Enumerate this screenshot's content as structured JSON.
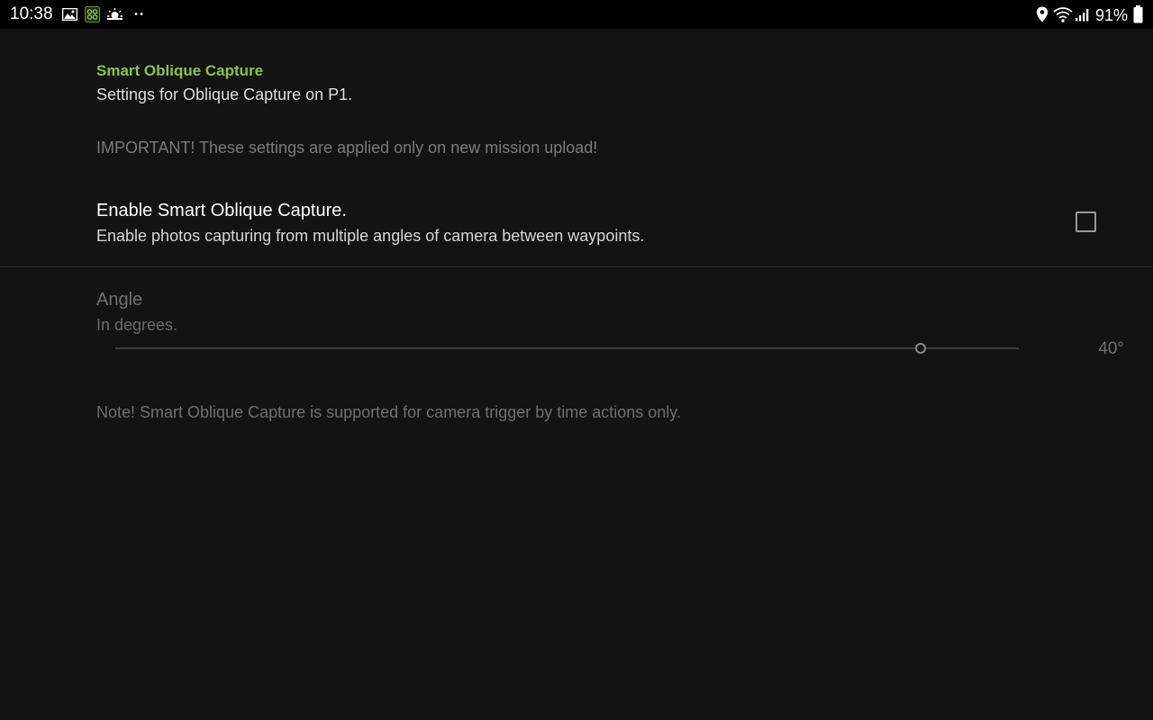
{
  "status_bar": {
    "time": "10:38",
    "left_icons": [
      "gallery-icon",
      "app-icon",
      "weather-icon",
      "more-notifications-icon"
    ],
    "right_icons": [
      "location-icon",
      "wifi-icon",
      "signal-icon",
      "battery-icon"
    ],
    "battery_percent": "91%"
  },
  "section": {
    "title": "Smart Oblique Capture",
    "subtitle": "Settings for Oblique Capture on P1.",
    "important": "IMPORTANT! These settings are applied only on new mission upload!"
  },
  "enable_pref": {
    "title": "Enable Smart Oblique Capture.",
    "summary": "Enable photos capturing from multiple angles of camera between waypoints.",
    "checked": false
  },
  "angle_pref": {
    "title": "Angle",
    "summary": "In degrees.",
    "value_label": "40°",
    "position_fraction": 0.891,
    "enabled": false
  },
  "note": "Note! Smart Oblique Capture is supported for camera trigger by time actions only.",
  "colors": {
    "accent": "#8bc34a",
    "background": "#131313",
    "statusbar": "#000000"
  }
}
